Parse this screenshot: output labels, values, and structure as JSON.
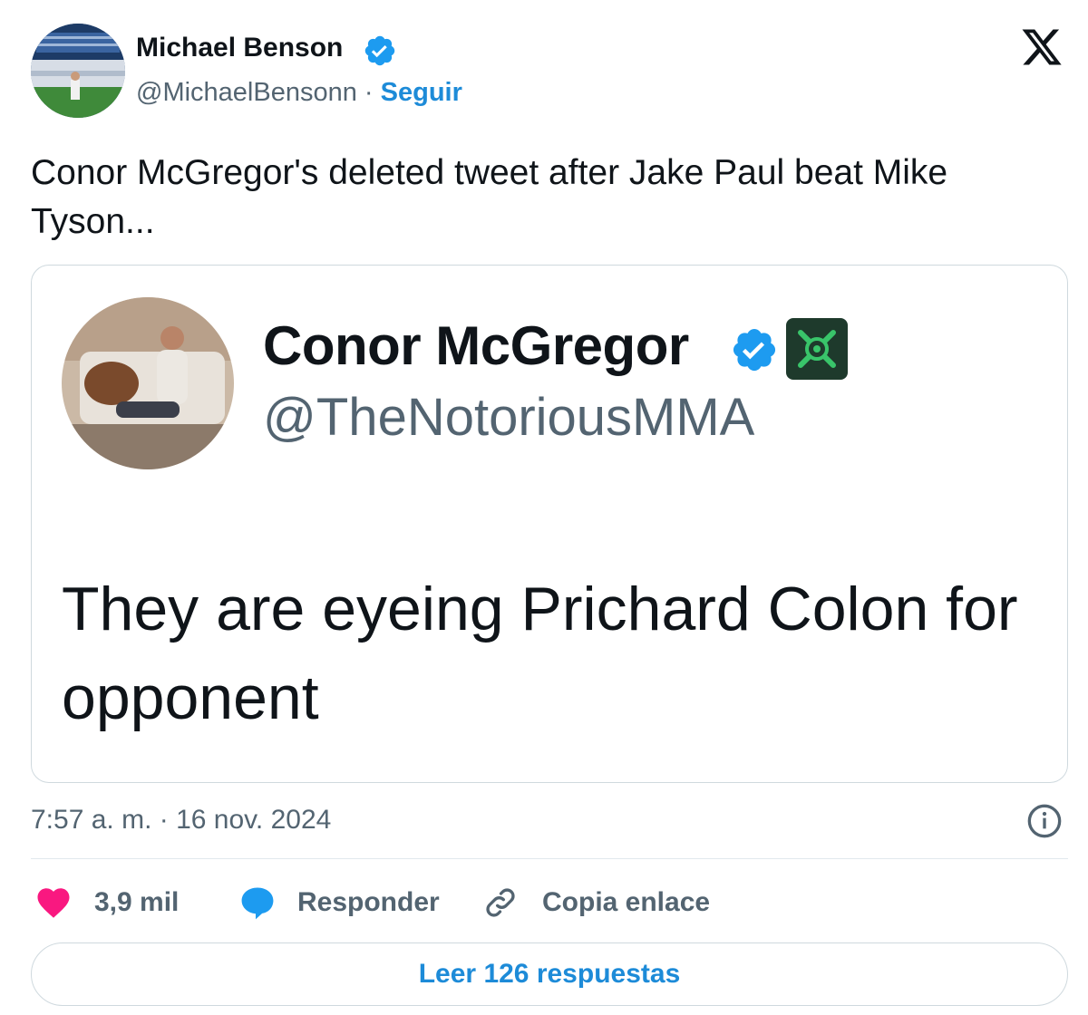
{
  "author": {
    "name": "Michael Benson",
    "handle": "@MichaelBensonn",
    "separator": " · ",
    "follow_label": "Seguir",
    "avatar_icon": "stadium-photo-avatar",
    "verified_icon": "verified-badge-icon"
  },
  "tweet": {
    "text": "Conor McGregor's deleted tweet after Jake Paul beat Mike Tyson..."
  },
  "embedded_tweet": {
    "name": "Conor McGregor",
    "handle": "@TheNotoriousMMA",
    "text_line1": "They are eyeing Prichard Colon for",
    "text_line2": "opponent",
    "affiliate_icon": "affiliate-badge-icon"
  },
  "meta": {
    "timestamp": "7:57 a. m. · 16 nov. 2024"
  },
  "actions": {
    "likes": "3,9 mil",
    "reply_label": "Responder",
    "copy_link_label": "Copia enlace"
  },
  "footer": {
    "read_replies_label": "Leer 126 respuestas"
  },
  "colors": {
    "accent": "#1d8bd8",
    "like": "#f91880",
    "text": "#0f1419",
    "muted": "#536471",
    "border": "#cfd9de"
  }
}
